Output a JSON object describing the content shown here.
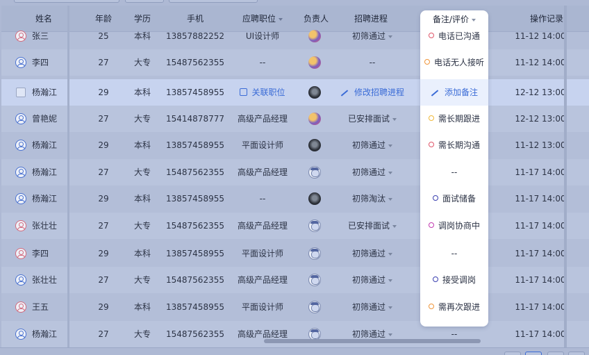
{
  "headers": {
    "name": "姓名",
    "age": "年龄",
    "edu": "学历",
    "phone": "手机",
    "position": "应聘职位",
    "owner": "负责人",
    "progress": "招聘进程",
    "notes": "备注/评价",
    "ops": "操作记录"
  },
  "rows": [
    {
      "name": "张三",
      "gender": "f",
      "age": "25",
      "edu": "本科",
      "phone": "13857882252",
      "position": "UI设计师",
      "avatar": "color",
      "progress": "初筛通过",
      "progress_caret": true,
      "note": "电话已沟通",
      "note_color": "#e0566a",
      "time": "11-12 14:00"
    },
    {
      "name": "李四",
      "gender": "m",
      "age": "27",
      "edu": "大专",
      "phone": "15487562355",
      "position": "--",
      "avatar": "color",
      "progress": "--",
      "progress_caret": false,
      "note": "电话无人接听",
      "note_color": "#f0953a",
      "time": "11-12 14:00"
    },
    {
      "name": "杨瀚江",
      "gender": "check",
      "age": "29",
      "edu": "本科",
      "phone": "13857458955",
      "position": "关联职位",
      "avatar": "dark",
      "progress": "修改招聘进程",
      "progress_caret": false,
      "note": "添加备注",
      "note_color": "",
      "time": "12-12 13:00",
      "highlight": true
    },
    {
      "name": "曾艳妮",
      "gender": "m",
      "age": "27",
      "edu": "大专",
      "phone": "15414878777",
      "position": "高级产品经理",
      "avatar": "color",
      "progress": "已安排面试",
      "progress_caret": true,
      "note": "需长期跟进",
      "note_color": "#f0b93a",
      "time": "12-12 13:00"
    },
    {
      "name": "杨瀚江",
      "gender": "m",
      "age": "29",
      "edu": "本科",
      "phone": "13857458955",
      "position": "平面设计师",
      "avatar": "dark",
      "progress": "初筛通过",
      "progress_caret": true,
      "note": "需长期沟通",
      "note_color": "#e0566a",
      "time": "11-12 13:00"
    },
    {
      "name": "杨瀚江",
      "gender": "m",
      "age": "27",
      "edu": "大专",
      "phone": "15487562355",
      "position": "高级产品经理",
      "avatar": "cartoon",
      "progress": "初筛通过",
      "progress_caret": true,
      "note": "--",
      "note_color": "",
      "time": "11-17 14:00"
    },
    {
      "name": "杨瀚江",
      "gender": "m",
      "age": "29",
      "edu": "本科",
      "phone": "13857458955",
      "position": "--",
      "avatar": "dark",
      "progress": "初筛淘汰",
      "progress_caret": true,
      "note": "面试储备",
      "note_color": "#3a3fb0",
      "time": "11-17 14:00"
    },
    {
      "name": "张壮壮",
      "gender": "f",
      "age": "27",
      "edu": "大专",
      "phone": "15487562355",
      "position": "高级产品经理",
      "avatar": "cartoon",
      "progress": "已安排面试",
      "progress_caret": true,
      "note": "调岗协商中",
      "note_color": "#c23ab0",
      "time": "11-17 14:00"
    },
    {
      "name": "李四",
      "gender": "f",
      "age": "29",
      "edu": "本科",
      "phone": "13857458955",
      "position": "平面设计师",
      "avatar": "cartoon",
      "progress": "初筛通过",
      "progress_caret": true,
      "note": "--",
      "note_color": "",
      "time": "11-17 14:00"
    },
    {
      "name": "张壮壮",
      "gender": "m",
      "age": "27",
      "edu": "大专",
      "phone": "15487562355",
      "position": "高级产品经理",
      "avatar": "cartoon",
      "progress": "初筛通过",
      "progress_caret": true,
      "note": "接受调岗",
      "note_color": "#3a3fb0",
      "time": "11-17 14:00"
    },
    {
      "name": "王五",
      "gender": "f",
      "age": "29",
      "edu": "本科",
      "phone": "13857458955",
      "position": "平面设计师",
      "avatar": "cartoon",
      "progress": "初筛通过",
      "progress_caret": true,
      "note": "需再次跟进",
      "note_color": "#f0953a",
      "time": "11-17 14:00"
    },
    {
      "name": "杨瀚江",
      "gender": "m",
      "age": "27",
      "edu": "大专",
      "phone": "15487562355",
      "position": "高级产品经理",
      "avatar": "cartoon",
      "progress": "初筛通过",
      "progress_caret": true,
      "note": "--",
      "note_color": "",
      "time": "11-17 14:00"
    }
  ]
}
